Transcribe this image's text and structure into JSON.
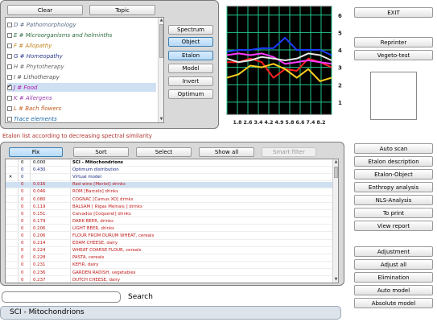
{
  "top": {
    "clear_label": "Clear",
    "topic_label": "Topic",
    "topics": [
      {
        "code": "D",
        "label": "D # Pathomorphology",
        "color": "#5a6e8a",
        "checked": false,
        "selected": false
      },
      {
        "code": "E",
        "label": "E # Microorganisms and helminths",
        "color": "#2f6b3f",
        "checked": false,
        "selected": false
      },
      {
        "code": "F",
        "label": "F # Allopathy",
        "color": "#c0811d",
        "checked": false,
        "selected": false
      },
      {
        "code": "G",
        "label": "G # Homeopathy",
        "color": "#2a3a8c",
        "checked": false,
        "selected": false
      },
      {
        "code": "H",
        "label": "H # Phytotherapy",
        "color": "#6a6a6a",
        "checked": false,
        "selected": false
      },
      {
        "code": "I",
        "label": "I # Lithotherapy",
        "color": "#555555",
        "checked": false,
        "selected": false
      },
      {
        "code": "J",
        "label": "J # Food",
        "color": "#b014b0",
        "checked": true,
        "selected": true
      },
      {
        "code": "K",
        "label": "K # Allergens",
        "color": "#9a3ab0",
        "checked": false,
        "selected": false
      },
      {
        "code": "L",
        "label": "L # Bach flowers",
        "color": "#c05a1a",
        "checked": false,
        "selected": false
      },
      {
        "code": "M",
        "label": "Trace elements",
        "color": "#1c6aa8",
        "checked": false,
        "selected": false
      }
    ]
  },
  "side_buttons": {
    "spectrum": "Spectrum",
    "object": "Object",
    "etalon": "Etalon",
    "model": "Model",
    "invert": "Invert",
    "optimum": "Optimum"
  },
  "chart_data": {
    "type": "line",
    "x_ticks": [
      "1.8",
      "2.6",
      "3.4",
      "4.2",
      "4.9",
      "5.8",
      "6.6",
      "7.4",
      "8.2"
    ],
    "y_ticks": [
      "1",
      "2",
      "3",
      "4",
      "5",
      "6"
    ],
    "ylim": [
      0.3,
      6.5
    ],
    "grid": true,
    "background": "#000000",
    "grid_color": "#22c88a",
    "series": [
      {
        "color": "#1a3cff",
        "values": [
          3.9,
          4.0,
          4.0,
          4.1,
          4.1,
          4.7,
          4.0,
          4.0,
          4.0,
          3.7
        ]
      },
      {
        "color": "#ff2020",
        "values": [
          3.3,
          3.3,
          3.5,
          3.3,
          2.4,
          2.9,
          2.8,
          3.5,
          3.3,
          3.0
        ]
      },
      {
        "color": "#ff3cff",
        "values": [
          3.7,
          3.8,
          3.7,
          3.8,
          3.6,
          3.2,
          3.3,
          3.4,
          3.3,
          3.2
        ]
      },
      {
        "color": "#e8e8e8",
        "values": [
          3.5,
          3.3,
          3.4,
          3.6,
          3.5,
          3.4,
          3.5,
          3.8,
          3.7,
          3.4
        ]
      },
      {
        "color": "#ffd020",
        "values": [
          2.4,
          2.6,
          3.1,
          3.0,
          3.2,
          2.9,
          2.4,
          2.9,
          2.2,
          2.4
        ]
      }
    ]
  },
  "right_top": {
    "exit": "EXIT",
    "reprinter": "Reprinter",
    "vegeto": "Vegeto-test"
  },
  "note": "Etalon list according to decreasing spectral similarity",
  "toolbar": {
    "fix": "Fix",
    "sort": "Sort",
    "select": "Select",
    "show_all": "Show all",
    "smart_filter": "Smart filter"
  },
  "rows": [
    {
      "mark": "",
      "idx": "0",
      "val": "0.000",
      "name": "SCI - Mitochondrions",
      "color": "#000000",
      "bold": true
    },
    {
      "mark": "",
      "idx": "0",
      "val": "0.430",
      "name": "Optimum distribution",
      "color": "#1a2a80",
      "bold": false
    },
    {
      "mark": "x",
      "idx": "0",
      "val": "",
      "name": "Virtual model",
      "color": "#1a2a80",
      "bold": false
    },
    {
      "mark": "",
      "idx": "0",
      "val": "0.016",
      "name": "Red wine [Merlot] drinks",
      "color": "#c01818",
      "bold": false,
      "selected": true
    },
    {
      "mark": "",
      "idx": "0",
      "val": "0.046",
      "name": "ROM [Barcelo] drinks",
      "color": "#c01818",
      "bold": false
    },
    {
      "mark": "",
      "idx": "0",
      "val": "0.080",
      "name": "COGNAC [Camus XO] drinks",
      "color": "#c01818",
      "bold": false
    },
    {
      "mark": "",
      "idx": "0",
      "val": "0.119",
      "name": "BALSAM [ Rigas Melnais ] drinks",
      "color": "#c01818",
      "bold": false
    },
    {
      "mark": "",
      "idx": "0",
      "val": "0.151",
      "name": "Calvados [Coquerel] drinks",
      "color": "#c01818",
      "bold": false
    },
    {
      "mark": "",
      "idx": "0",
      "val": "0.179",
      "name": "DARK BEER, drinks",
      "color": "#c01818",
      "bold": false
    },
    {
      "mark": "",
      "idx": "0",
      "val": "0.206",
      "name": "LIGHT BEER, drinks",
      "color": "#c01818",
      "bold": false
    },
    {
      "mark": "",
      "idx": "0",
      "val": "0.206",
      "name": "FLOUR FROM DURUM WHEAT, cereals",
      "color": "#c01818",
      "bold": false
    },
    {
      "mark": "",
      "idx": "0",
      "val": "0.214",
      "name": "EDAM CHEESE, dairy",
      "color": "#c01818",
      "bold": false
    },
    {
      "mark": "",
      "idx": "0",
      "val": "0.224",
      "name": "WHEAT COARSE FLOUR, cereals",
      "color": "#c01818",
      "bold": false
    },
    {
      "mark": "",
      "idx": "0",
      "val": "0.228",
      "name": "PASTA, cereals",
      "color": "#c01818",
      "bold": false
    },
    {
      "mark": "",
      "idx": "0",
      "val": "0.231",
      "name": "KEFIR, dairy",
      "color": "#c01818",
      "bold": false
    },
    {
      "mark": "",
      "idx": "0",
      "val": "0.236",
      "name": "GARDEN RADISH, vegetables",
      "color": "#c01818",
      "bold": false
    },
    {
      "mark": "",
      "idx": "0",
      "val": "0.237",
      "name": "DUTCH CHEESE, dairy",
      "color": "#c01818",
      "bold": false
    }
  ],
  "right_bottom": {
    "auto_scan": "Auto scan",
    "etalon_description": "Etalon description",
    "etalon_object": "Etalon-Object",
    "enthropy": "Enthropy analysis",
    "nls": "NLS-Analysis",
    "to_print": "To print",
    "view_report": "View report",
    "adjustment": "Adjustment",
    "adjust_all": "Adjust all",
    "elimination": "Elimination",
    "auto_model": "Auto model",
    "absolute_model": "Absolute model"
  },
  "search": {
    "label": "Search",
    "value": ""
  },
  "status": "SCI - Mitochondrions"
}
